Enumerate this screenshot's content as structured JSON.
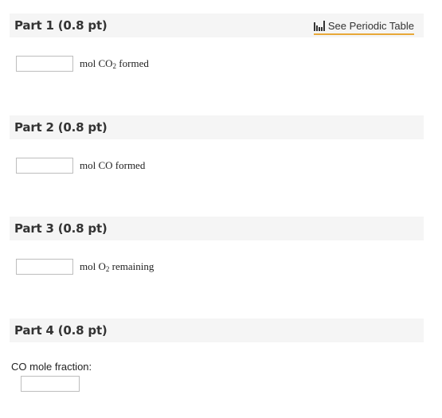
{
  "parts": [
    {
      "title": "Part 1 (0.8 pt)",
      "answer_value": "",
      "unit_prefix": "mol CO",
      "unit_sub": "2",
      "unit_suffix": " formed"
    },
    {
      "title": "Part 2 (0.8 pt)",
      "answer_value": "",
      "unit_text": "mol CO formed"
    },
    {
      "title": "Part 3 (0.8 pt)",
      "answer_value": "",
      "unit_prefix": "mol O",
      "unit_sub": "2",
      "unit_suffix": " remaining"
    },
    {
      "title": "Part 4 (0.8 pt)",
      "field_label": "CO mole fraction:",
      "answer_value": ""
    }
  ],
  "periodic_table": {
    "label": "See Periodic Table",
    "icon": "periodic-table-icon"
  },
  "colors": {
    "header_background": "#f5f5f5",
    "link_underline": "#e8a838",
    "input_border": "#bdbdbd",
    "text": "#333333"
  }
}
